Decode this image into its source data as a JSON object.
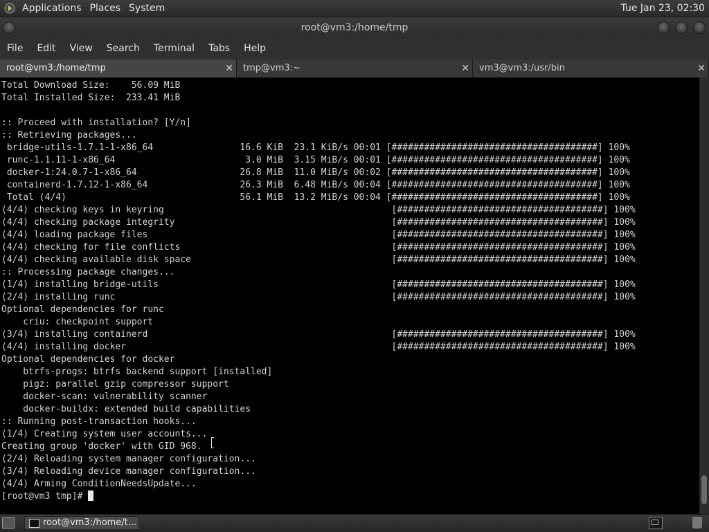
{
  "top_panel": {
    "menus": [
      "Applications",
      "Places",
      "System"
    ],
    "clock": "Tue Jan 23, 02:30"
  },
  "window": {
    "title": "root@vm3:/home/tmp"
  },
  "menubar": {
    "items": [
      "File",
      "Edit",
      "View",
      "Search",
      "Terminal",
      "Tabs",
      "Help"
    ]
  },
  "tabs": [
    {
      "label": "root@vm3:/home/tmp",
      "active": true
    },
    {
      "label": "tmp@vm3:~",
      "active": false
    },
    {
      "label": "vm3@vm3:/usr/bin",
      "active": false
    }
  ],
  "terminal": {
    "lines": [
      "Total Download Size:    56.09 MiB",
      "Total Installed Size:  233.41 MiB",
      "",
      ":: Proceed with installation? [Y/n]",
      ":: Retrieving packages...",
      " bridge-utils-1.7.1-1-x86_64                16.6 KiB  23.1 KiB/s 00:01 [######################################] 100%",
      " runc-1.1.11-1-x86_64                        3.0 MiB  3.15 MiB/s 00:01 [######################################] 100%",
      " docker-1:24.0.7-1-x86_64                   26.8 MiB  11.0 MiB/s 00:02 [######################################] 100%",
      " containerd-1.7.12-1-x86_64                 26.3 MiB  6.48 MiB/s 00:04 [######################################] 100%",
      " Total (4/4)                                56.1 MiB  13.2 MiB/s 00:04 [######################################] 100%",
      "(4/4) checking keys in keyring                                          [######################################] 100%",
      "(4/4) checking package integrity                                        [######################################] 100%",
      "(4/4) loading package files                                             [######################################] 100%",
      "(4/4) checking for file conflicts                                       [######################################] 100%",
      "(4/4) checking available disk space                                     [######################################] 100%",
      ":: Processing package changes...",
      "(1/4) installing bridge-utils                                           [######################################] 100%",
      "(2/4) installing runc                                                   [######################################] 100%",
      "Optional dependencies for runc",
      "    criu: checkpoint support",
      "(3/4) installing containerd                                             [######################################] 100%",
      "(4/4) installing docker                                                 [######################################] 100%",
      "Optional dependencies for docker",
      "    btrfs-progs: btrfs backend support [installed]",
      "    pigz: parallel gzip compressor support",
      "    docker-scan: vulnerability scanner",
      "    docker-buildx: extended build capabilities",
      ":: Running post-transaction hooks...",
      "(1/4) Creating system user accounts...",
      "Creating group 'docker' with GID 968.",
      "(2/4) Reloading system manager configuration...",
      "(3/4) Reloading device manager configuration...",
      "(4/4) Arming ConditionNeedsUpdate..."
    ],
    "prompt": "[root@vm3 tmp]# "
  },
  "taskbar": {
    "task_label": "root@vm3:/home/t..."
  }
}
